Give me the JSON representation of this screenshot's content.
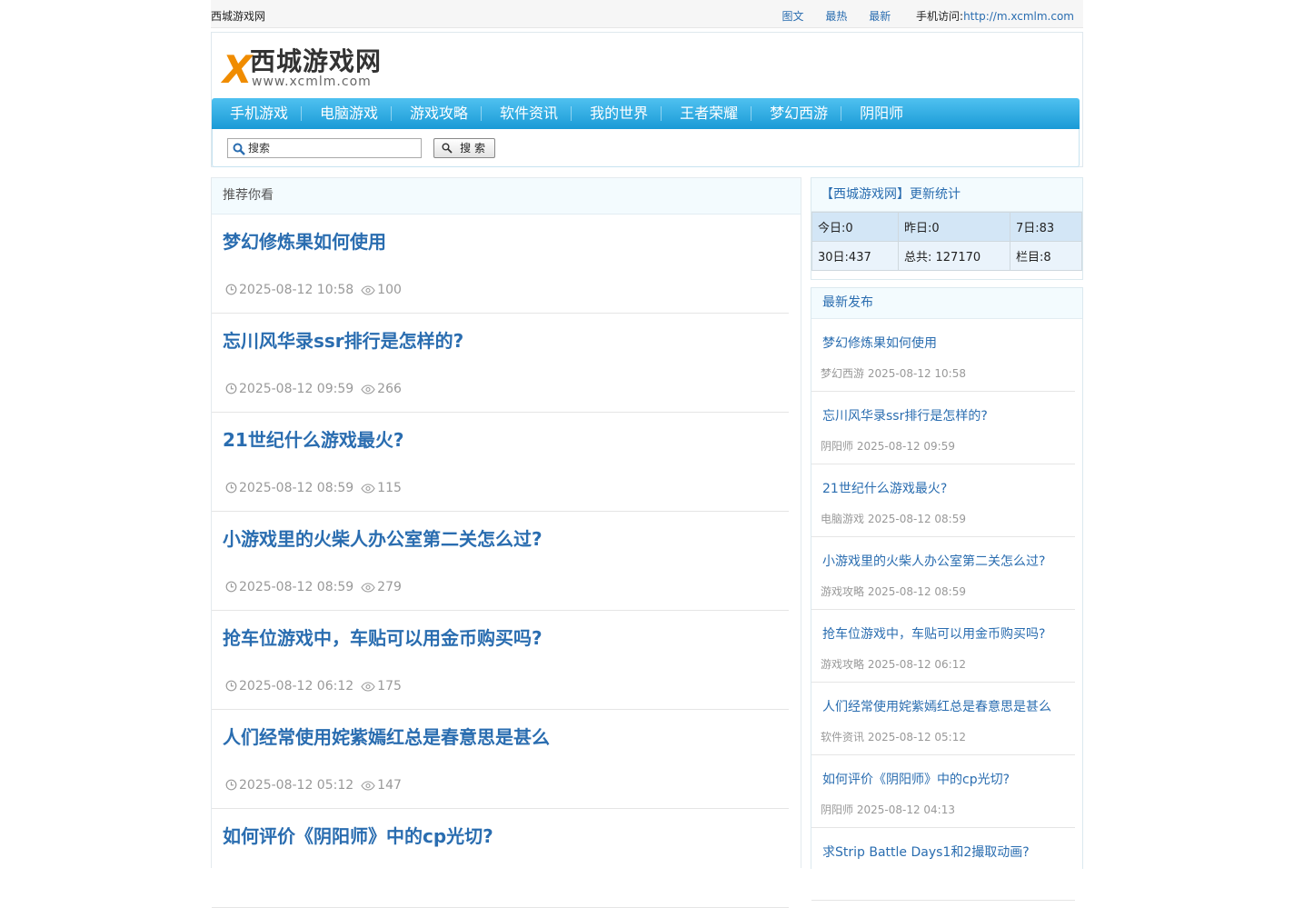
{
  "topbar": {
    "site_name": "西城游戏网",
    "links": [
      "图文",
      "最热",
      "最新"
    ],
    "mobile_label": "手机访问:",
    "mobile_url": "http://m.xcmlm.com"
  },
  "logo": {
    "letter": "X",
    "name": "西城游戏网",
    "url": "www.xcmlm.com"
  },
  "nav": [
    "手机游戏",
    "电脑游戏",
    "游戏攻略",
    "软件资讯",
    "我的世界",
    "王者荣耀",
    "梦幻西游",
    "阴阳师"
  ],
  "search": {
    "placeholder": "搜索",
    "button": "搜 索"
  },
  "main": {
    "heading": "推荐你看",
    "articles": [
      {
        "title": "梦幻修炼果如何使用",
        "date": "2025-08-12 10:58",
        "views": "100"
      },
      {
        "title": "忘川风华录ssr排行是怎样的?",
        "date": "2025-08-12 09:59",
        "views": "266"
      },
      {
        "title": "21世纪什么游戏最火?",
        "date": "2025-08-12 08:59",
        "views": "115"
      },
      {
        "title": "小游戏里的火柴人办公室第二关怎么过?",
        "date": "2025-08-12 08:59",
        "views": "279"
      },
      {
        "title": "抢车位游戏中，车贴可以用金币购买吗?",
        "date": "2025-08-12 06:12",
        "views": "175"
      },
      {
        "title": "人们经常使用姹紫嫣红总是春意思是甚么",
        "date": "2025-08-12 05:12",
        "views": "147"
      },
      {
        "title": "如何评价《阴阳师》中的cp光切?",
        "date": "",
        "views": ""
      }
    ]
  },
  "stats": {
    "heading": "【西城游戏网】更新统计",
    "today": "今日:0",
    "yesterday": "昨日:0",
    "week": "7日:83",
    "month": "30日:437",
    "total": "总共: 127170",
    "columns": "栏目:8"
  },
  "latest": {
    "heading": "最新发布",
    "entries": [
      {
        "title": "梦幻修炼果如何使用",
        "category": "梦幻西游",
        "date": "2025-08-12 10:58"
      },
      {
        "title": "忘川风华录ssr排行是怎样的?",
        "category": "阴阳师",
        "date": "2025-08-12 09:59"
      },
      {
        "title": "21世纪什么游戏最火?",
        "category": "电脑游戏",
        "date": "2025-08-12 08:59"
      },
      {
        "title": "小游戏里的火柴人办公室第二关怎么过?",
        "category": "游戏攻略",
        "date": "2025-08-12 08:59"
      },
      {
        "title": "抢车位游戏中，车贴可以用金币购买吗?",
        "category": "游戏攻略",
        "date": "2025-08-12 06:12"
      },
      {
        "title": "人们经常使用姹紫嫣红总是春意思是甚么",
        "category": "软件资讯",
        "date": "2025-08-12 05:12"
      },
      {
        "title": "如何评价《阴阳师》中的cp光切?",
        "category": "阴阳师",
        "date": "2025-08-12 04:13"
      },
      {
        "title": "求Strip Battle Days1和2撮取动画?",
        "category": "",
        "date": ""
      }
    ]
  }
}
